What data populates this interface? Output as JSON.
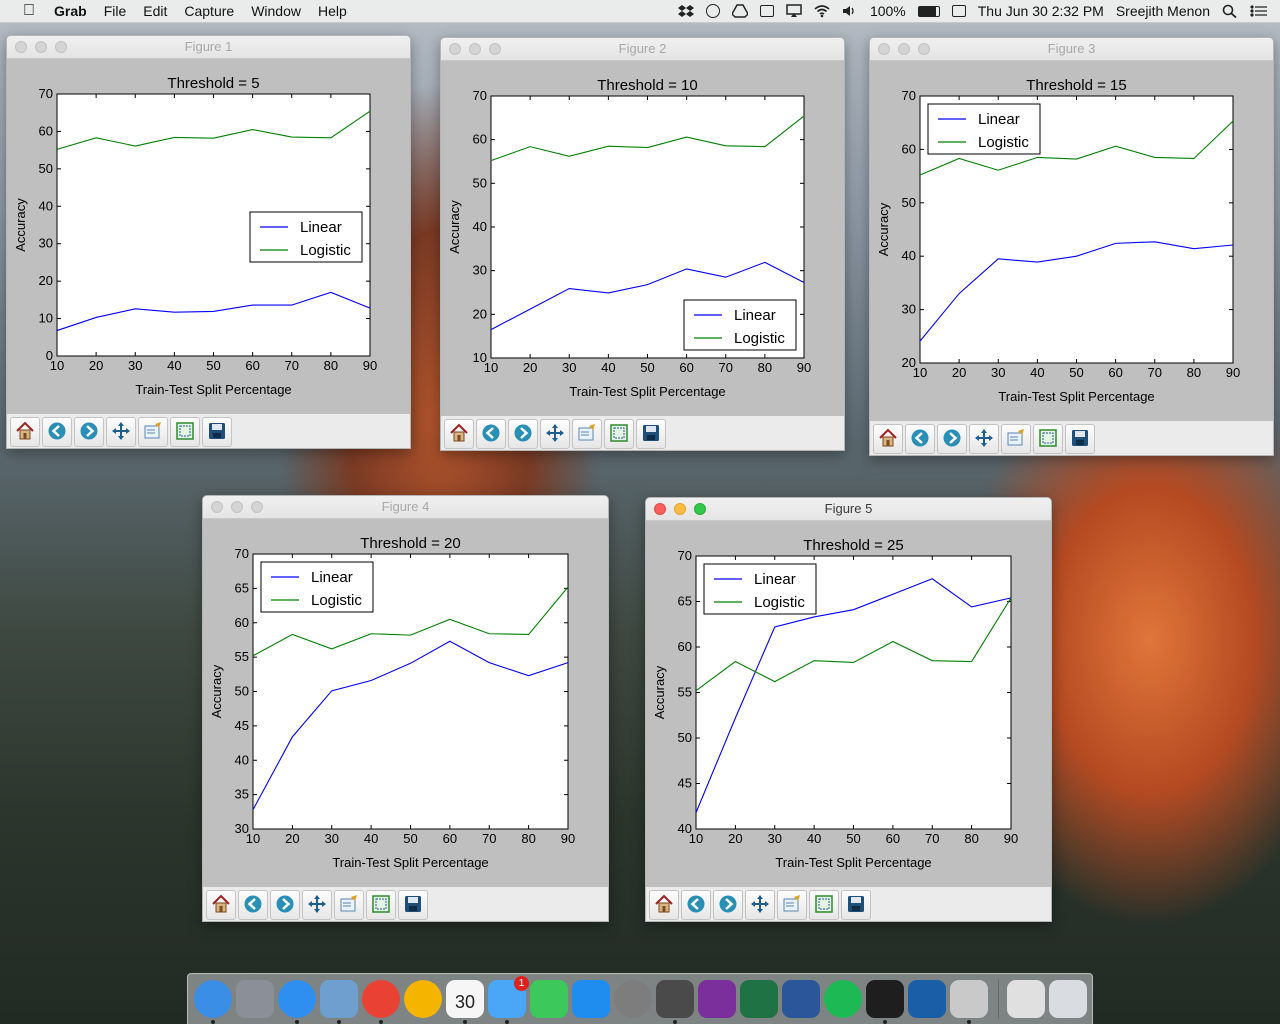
{
  "menubar": {
    "app_name": "Grab",
    "items": [
      "File",
      "Edit",
      "Capture",
      "Window",
      "Help"
    ],
    "battery": "100%",
    "datetime": "Thu Jun 30  2:32 PM",
    "user": "Sreejith Menon"
  },
  "common": {
    "xlabel": "Train-Test Split Percentage",
    "ylabel": "Accuracy",
    "x": [
      10,
      20,
      30,
      40,
      50,
      60,
      70,
      80,
      90
    ],
    "legend": [
      "Linear",
      "Logistic"
    ],
    "line_colors": {
      "Linear": "#0000ff",
      "Logistic": "#008000"
    },
    "toolbar_tools": [
      "home-icon",
      "back-icon",
      "forward-icon",
      "pan-icon",
      "subplots-icon",
      "zoom-rect-icon",
      "save-icon"
    ]
  },
  "figures": [
    {
      "window_title": "Figure 1",
      "title": "Threshold = 5",
      "legend_loc": "center-right",
      "ylim": [
        0,
        70
      ],
      "yticks": [
        0,
        10,
        20,
        30,
        40,
        50,
        60,
        70
      ],
      "linear": [
        6.8,
        10.3,
        12.6,
        11.7,
        11.9,
        13.6,
        13.6,
        17.0,
        12.8
      ],
      "logistic": [
        55.2,
        58.3,
        56.1,
        58.4,
        58.2,
        60.5,
        58.5,
        58.3,
        65.4
      ]
    },
    {
      "window_title": "Figure 2",
      "title": "Threshold = 10",
      "legend_loc": "lower-right",
      "ylim": [
        10,
        70
      ],
      "yticks": [
        10,
        20,
        30,
        40,
        50,
        60,
        70
      ],
      "linear": [
        16.5,
        21.2,
        25.9,
        24.9,
        26.8,
        30.4,
        28.5,
        31.9,
        27.3
      ],
      "logistic": [
        55.2,
        58.4,
        56.2,
        58.5,
        58.2,
        60.6,
        58.6,
        58.4,
        65.4
      ]
    },
    {
      "window_title": "Figure 3",
      "title": "Threshold = 15",
      "legend_loc": "upper-left",
      "ylim": [
        20,
        70
      ],
      "yticks": [
        20,
        30,
        40,
        50,
        60,
        70
      ],
      "linear": [
        24.1,
        33.0,
        39.5,
        38.9,
        40.0,
        42.4,
        42.7,
        41.4,
        42.1
      ],
      "logistic": [
        55.2,
        58.3,
        56.1,
        58.5,
        58.2,
        60.6,
        58.5,
        58.3,
        65.3
      ]
    },
    {
      "window_title": "Figure 4",
      "title": "Threshold = 20",
      "legend_loc": "upper-left",
      "ylim": [
        30,
        70
      ],
      "yticks": [
        30,
        35,
        40,
        45,
        50,
        55,
        60,
        65,
        70
      ],
      "linear": [
        32.8,
        43.4,
        50.1,
        51.6,
        54.1,
        57.3,
        54.2,
        52.3,
        54.2
      ],
      "logistic": [
        55.2,
        58.3,
        56.2,
        58.4,
        58.2,
        60.5,
        58.4,
        58.3,
        65.2
      ]
    },
    {
      "window_title": "Figure 5",
      "title": "Threshold = 25",
      "legend_loc": "upper-left",
      "ylim": [
        40,
        70
      ],
      "yticks": [
        40,
        45,
        50,
        55,
        60,
        65,
        70
      ],
      "linear": [
        41.8,
        52.2,
        62.2,
        63.3,
        64.1,
        65.8,
        67.5,
        64.4,
        65.4
      ],
      "logistic": [
        55.2,
        58.4,
        56.2,
        58.5,
        58.3,
        60.6,
        58.5,
        58.4,
        65.4
      ]
    }
  ],
  "chart_data": [
    {
      "type": "line",
      "title": "Threshold = 5",
      "xlabel": "Train-Test Split Percentage",
      "ylabel": "Accuracy",
      "ylim": [
        0,
        70
      ],
      "x": [
        10,
        20,
        30,
        40,
        50,
        60,
        70,
        80,
        90
      ],
      "series": [
        {
          "name": "Linear",
          "values": [
            6.8,
            10.3,
            12.6,
            11.7,
            11.9,
            13.6,
            13.6,
            17.0,
            12.8
          ]
        },
        {
          "name": "Logistic",
          "values": [
            55.2,
            58.3,
            56.1,
            58.4,
            58.2,
            60.5,
            58.5,
            58.3,
            65.4
          ]
        }
      ]
    },
    {
      "type": "line",
      "title": "Threshold = 10",
      "xlabel": "Train-Test Split Percentage",
      "ylabel": "Accuracy",
      "ylim": [
        10,
        70
      ],
      "x": [
        10,
        20,
        30,
        40,
        50,
        60,
        70,
        80,
        90
      ],
      "series": [
        {
          "name": "Linear",
          "values": [
            16.5,
            21.2,
            25.9,
            24.9,
            26.8,
            30.4,
            28.5,
            31.9,
            27.3
          ]
        },
        {
          "name": "Logistic",
          "values": [
            55.2,
            58.4,
            56.2,
            58.5,
            58.2,
            60.6,
            58.6,
            58.4,
            65.4
          ]
        }
      ]
    },
    {
      "type": "line",
      "title": "Threshold = 15",
      "xlabel": "Train-Test Split Percentage",
      "ylabel": "Accuracy",
      "ylim": [
        20,
        70
      ],
      "x": [
        10,
        20,
        30,
        40,
        50,
        60,
        70,
        80,
        90
      ],
      "series": [
        {
          "name": "Linear",
          "values": [
            24.1,
            33.0,
            39.5,
            38.9,
            40.0,
            42.4,
            42.7,
            41.4,
            42.1
          ]
        },
        {
          "name": "Logistic",
          "values": [
            55.2,
            58.3,
            56.1,
            58.5,
            58.2,
            60.6,
            58.5,
            58.3,
            65.3
          ]
        }
      ]
    },
    {
      "type": "line",
      "title": "Threshold = 20",
      "xlabel": "Train-Test Split Percentage",
      "ylabel": "Accuracy",
      "ylim": [
        30,
        70
      ],
      "x": [
        10,
        20,
        30,
        40,
        50,
        60,
        70,
        80,
        90
      ],
      "series": [
        {
          "name": "Linear",
          "values": [
            32.8,
            43.4,
            50.1,
            51.6,
            54.1,
            57.3,
            54.2,
            52.3,
            54.2
          ]
        },
        {
          "name": "Logistic",
          "values": [
            55.2,
            58.3,
            56.2,
            58.4,
            58.2,
            60.5,
            58.4,
            58.3,
            65.2
          ]
        }
      ]
    },
    {
      "type": "line",
      "title": "Threshold = 25",
      "xlabel": "Train-Test Split Percentage",
      "ylabel": "Accuracy",
      "ylim": [
        40,
        70
      ],
      "x": [
        10,
        20,
        30,
        40,
        50,
        60,
        70,
        80,
        90
      ],
      "series": [
        {
          "name": "Linear",
          "values": [
            41.8,
            52.2,
            62.2,
            63.3,
            64.1,
            65.8,
            67.5,
            64.4,
            65.4
          ]
        },
        {
          "name": "Logistic",
          "values": [
            55.2,
            58.4,
            56.2,
            58.5,
            58.3,
            60.6,
            58.5,
            58.4,
            65.4
          ]
        }
      ]
    }
  ],
  "dock": {
    "items": [
      {
        "name": "finder",
        "color": "#3a8ee6",
        "running": true
      },
      {
        "name": "launchpad",
        "color": "#8a8f98",
        "running": false
      },
      {
        "name": "safari",
        "color": "#2f8ff0",
        "running": true
      },
      {
        "name": "preview",
        "color": "#6e9fcf",
        "running": true
      },
      {
        "name": "chrome",
        "color": "#e94235",
        "running": true
      },
      {
        "name": "photos",
        "color": "#f4b400",
        "running": false
      },
      {
        "name": "calendar",
        "color": "#f6f6f6",
        "running": true,
        "label": "30"
      },
      {
        "name": "messages",
        "color": "#4aa6f7",
        "running": true,
        "badge": "1"
      },
      {
        "name": "facetime",
        "color": "#3cc85a",
        "running": false
      },
      {
        "name": "app-store",
        "color": "#1f8df0",
        "running": false
      },
      {
        "name": "system-preferences",
        "color": "#7d7d7d",
        "running": false
      },
      {
        "name": "sublime-text",
        "color": "#4a4a4a",
        "running": true
      },
      {
        "name": "onenote",
        "color": "#7b2f9c",
        "running": false
      },
      {
        "name": "excel",
        "color": "#1f7244",
        "running": false
      },
      {
        "name": "word",
        "color": "#2b579a",
        "running": false
      },
      {
        "name": "spotify",
        "color": "#1db954",
        "running": false
      },
      {
        "name": "terminal",
        "color": "#1e1e1e",
        "running": true
      },
      {
        "name": "virtualbox",
        "color": "#1b5ea8",
        "running": false
      },
      {
        "name": "grab",
        "color": "#c9c9c9",
        "running": true
      },
      {
        "name": "downloads",
        "color": "#e0e0e0",
        "running": false
      },
      {
        "name": "trash",
        "color": "#d9dde2",
        "running": false
      }
    ]
  }
}
